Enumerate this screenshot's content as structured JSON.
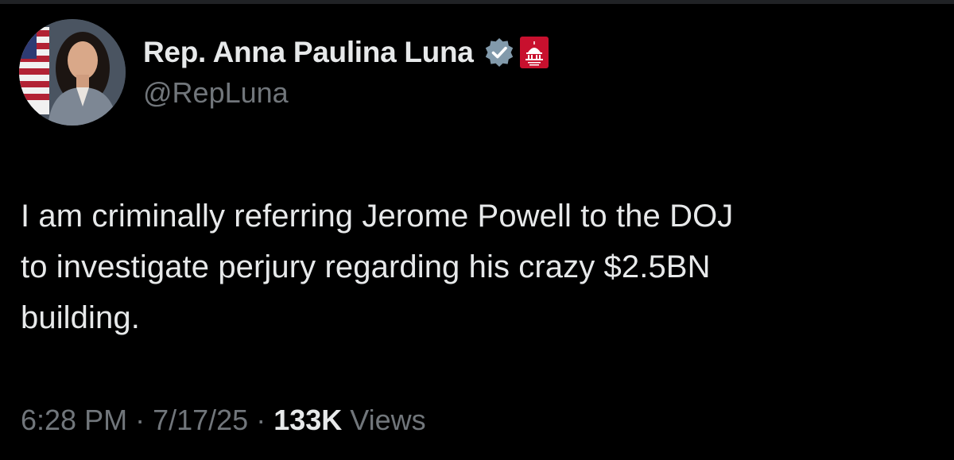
{
  "author": {
    "display_name": "Rep. Anna Paulina Luna",
    "handle": "@RepLuna",
    "verified_icon": "verified-badge-icon",
    "affiliation_icon": "house-gop-capitol-icon",
    "avatar_icon": "profile-photo-avatar"
  },
  "tweet": {
    "text": "I am criminally referring Jerome Powell to the DOJ\nto investigate perjury regarding his crazy $2.5BN\nbuilding."
  },
  "meta": {
    "time": "6:28 PM",
    "separator": "·",
    "date": "7/17/25",
    "views_count": "133K",
    "views_label": "Views"
  },
  "colors": {
    "background": "#000000",
    "primary_text": "#e7e9ea",
    "secondary_text": "#71767b",
    "affiliation_red": "#c8102e"
  }
}
